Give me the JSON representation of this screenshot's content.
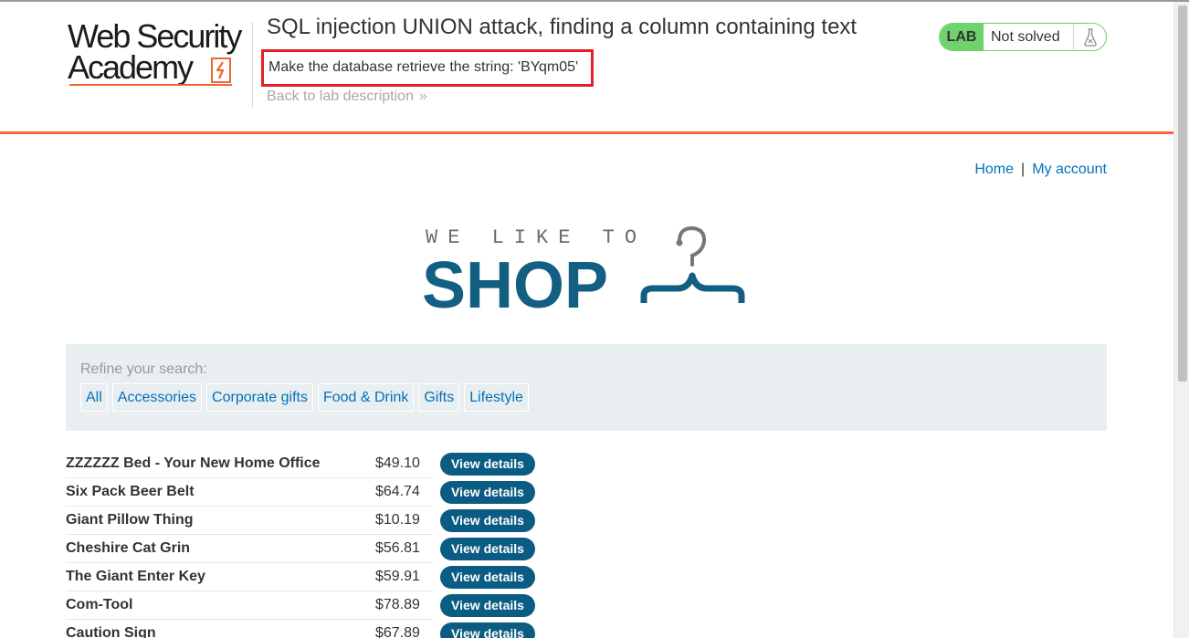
{
  "header": {
    "logo": {
      "line1": "Web Security",
      "line2": "Academy"
    },
    "lab_title": "SQL injection UNION attack, finding a column containing text",
    "goal_text": "Make the database retrieve the string: 'BYqm05'",
    "back_link": "Back to lab description",
    "lab_badge": "LAB",
    "lab_status": "Not solved"
  },
  "nav": {
    "home": "Home",
    "separator": "|",
    "my_account": "My account"
  },
  "shop_logo": {
    "tagline": "WE LIKE TO",
    "word": "SHOP",
    "icon": "hanger-icon"
  },
  "filter": {
    "label": "Refine your search:",
    "categories": [
      "All",
      "Accessories",
      "Corporate gifts",
      "Food & Drink",
      "Gifts",
      "Lifestyle"
    ]
  },
  "products": [
    {
      "name": "ZZZZZZ Bed - Your New Home Office",
      "price": "$49.10",
      "action": "View details"
    },
    {
      "name": "Six Pack Beer Belt",
      "price": "$64.74",
      "action": "View details"
    },
    {
      "name": "Giant Pillow Thing",
      "price": "$10.19",
      "action": "View details"
    },
    {
      "name": "Cheshire Cat Grin",
      "price": "$56.81",
      "action": "View details"
    },
    {
      "name": "The Giant Enter Key",
      "price": "$59.91",
      "action": "View details"
    },
    {
      "name": "Com-Tool",
      "price": "$78.89",
      "action": "View details"
    },
    {
      "name": "Caution Sign",
      "price": "$67.89",
      "action": "View details"
    }
  ],
  "colors": {
    "accent": "#ff6633",
    "link": "#0071bc",
    "button": "#0b5c83",
    "lab_green": "#70d26c",
    "highlight_box": "#e01f26"
  }
}
